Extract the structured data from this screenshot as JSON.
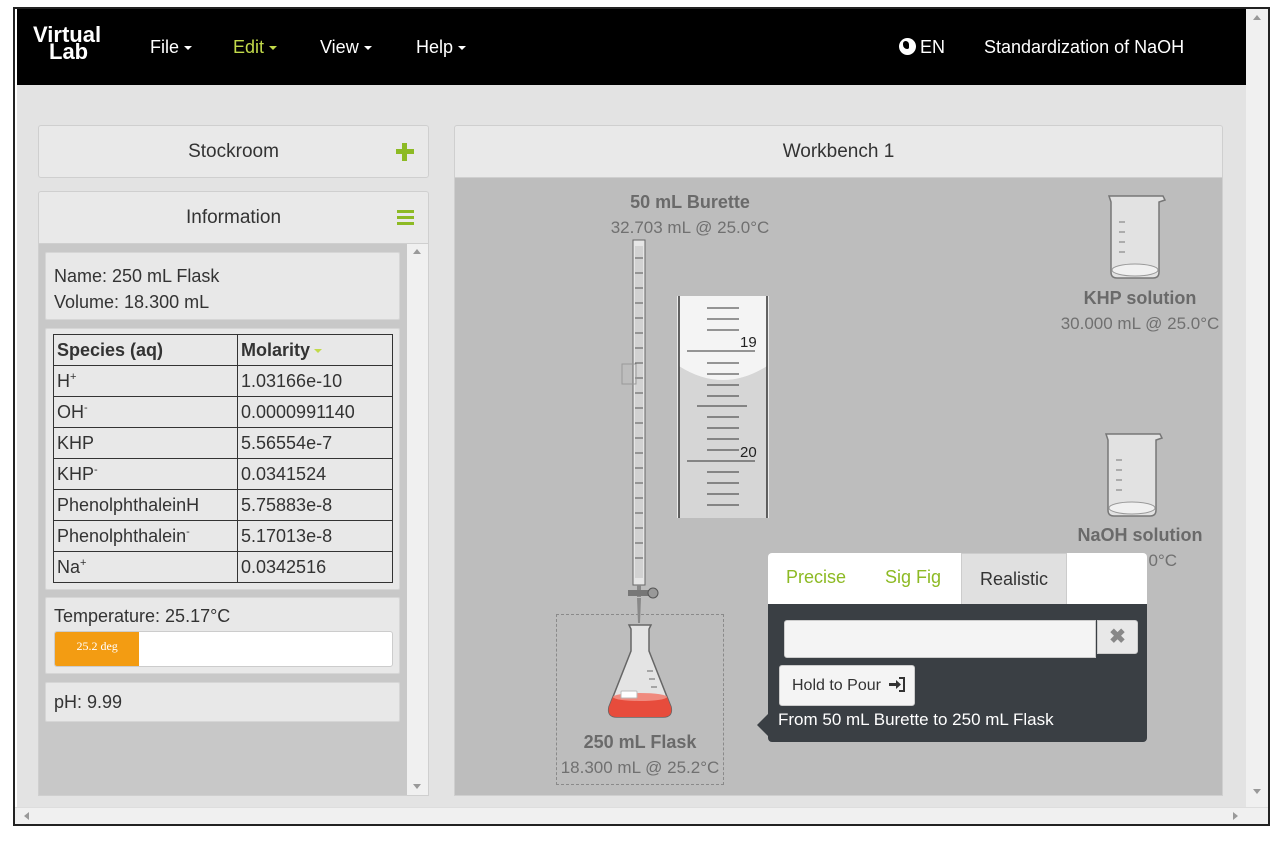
{
  "app": {
    "logo_line1": "Virtual",
    "logo_line2": "Lab",
    "menus": [
      "File",
      "Edit",
      "View",
      "Help"
    ],
    "active_menu": "Edit",
    "language": "EN",
    "title": "Standardization of NaOH"
  },
  "stockroom": {
    "title": "Stockroom"
  },
  "information": {
    "title": "Information",
    "name_label": "Name: 250 mL Flask",
    "volume_label": "Volume: 18.300 mL",
    "table": {
      "headers": [
        "Species (aq)",
        "Molarity"
      ],
      "rows": [
        {
          "species": "H",
          "sup": "+",
          "molarity": "1.03166e-10"
        },
        {
          "species": "OH",
          "sup": "-",
          "molarity": "0.0000991140"
        },
        {
          "species": "KHP",
          "sup": "",
          "molarity": "5.56554e-7"
        },
        {
          "species": "KHP",
          "sup": "-",
          "molarity": "0.0341524"
        },
        {
          "species": "PhenolphthaleinH",
          "sup": "",
          "molarity": "5.75883e-8"
        },
        {
          "species": "Phenolphthalein",
          "sup": "-",
          "molarity": "5.17013e-8"
        },
        {
          "species": "Na",
          "sup": "+",
          "molarity": "0.0342516"
        }
      ]
    },
    "temperature_label": "Temperature: 25.17°C",
    "temperature_bar_text": "25.2 deg",
    "temperature_fraction": 0.25,
    "ph_label": "pH: 9.99"
  },
  "workbench": {
    "title": "Workbench 1",
    "burette": {
      "name": "50 mL Burette",
      "volume": "32.703 mL @ 25.0°C",
      "scale_labels": [
        "19",
        "20"
      ]
    },
    "khp": {
      "name": "KHP solution",
      "volume": "30.000 mL @ 25.0°C"
    },
    "naoh": {
      "name": "NaOH solution",
      "volume": "@ 25.0°C"
    },
    "flask": {
      "name": "250 mL Flask",
      "volume": "18.300 mL @ 25.2°C"
    }
  },
  "pour_dialog": {
    "tabs": [
      "Precise",
      "Sig Fig",
      "Realistic"
    ],
    "active_tab": "Realistic",
    "input_value": "",
    "clear_symbol": "✖",
    "hold_button": "Hold to Pour",
    "description": "From 50 mL Burette to 250 mL Flask"
  },
  "colors": {
    "accent": "#8dba24",
    "menu_active": "#c2da4a",
    "temperature_bar": "#f39c12",
    "flask_liquid": "#e74c3c",
    "popover_bg": "#3a3f44"
  }
}
